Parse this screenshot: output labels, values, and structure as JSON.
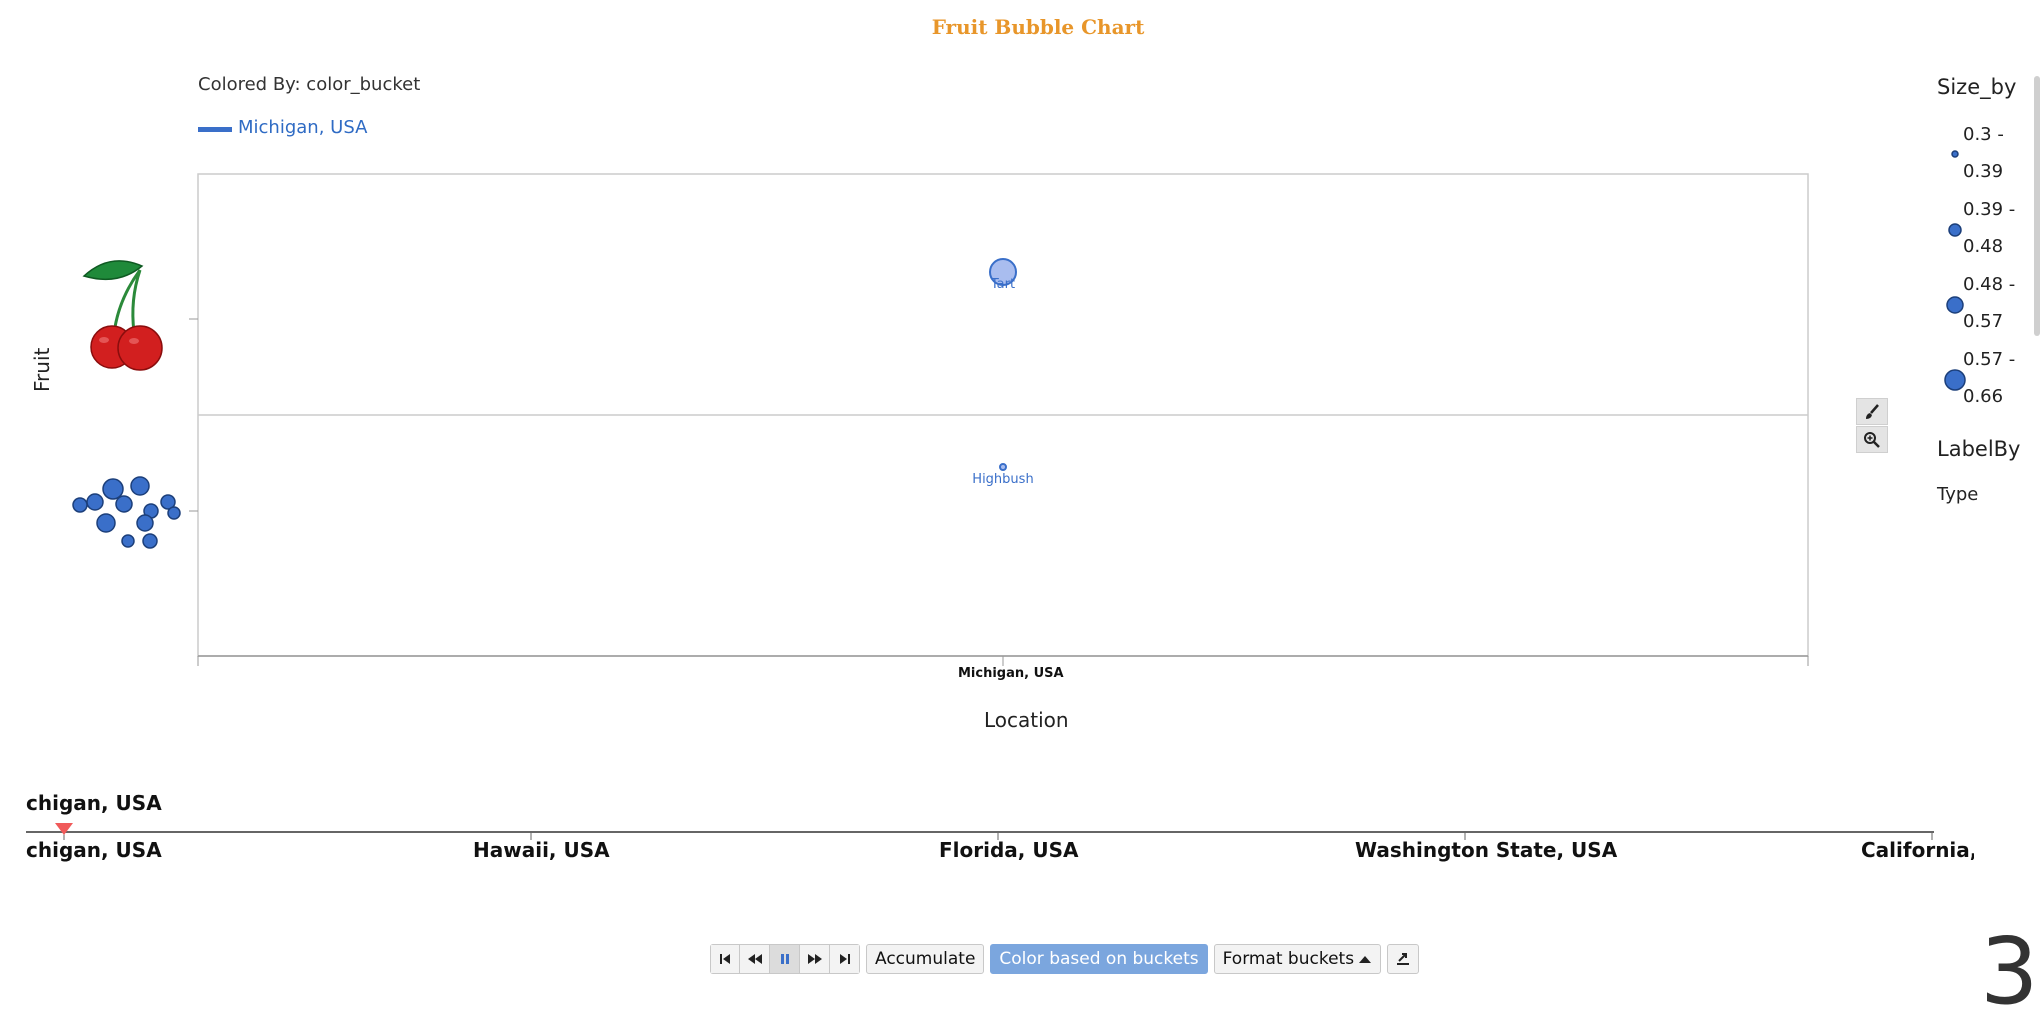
{
  "title": "Fruit Bubble Chart",
  "colored_by": "Colored By: color_bucket",
  "legend": {
    "series_label": "Michigan, USA",
    "series_color": "#3a6fc9"
  },
  "size_legend": {
    "title": "Size_by",
    "ranges": [
      {
        "line1": "0.3 -",
        "line2": "0.39"
      },
      {
        "line1": "0.39 -",
        "line2": "0.48"
      },
      {
        "line1": "0.48 -",
        "line2": "0.57"
      },
      {
        "line1": "0.57 -",
        "line2": "0.66"
      }
    ]
  },
  "label_legend": {
    "title": "LabelBy",
    "value": "Type"
  },
  "chart_data": {
    "type": "scatter",
    "title": "Fruit Bubble Chart",
    "xlabel": "Location",
    "ylabel": "Fruit",
    "x_categories": [
      "Michigan, USA"
    ],
    "y_categories": [
      "Cherry",
      "Blueberry"
    ],
    "y_category_icons": [
      "cherry-icon",
      "blueberry-icon"
    ],
    "points": [
      {
        "x": "Michigan, USA",
        "y": "Cherry",
        "label": "Tart",
        "size_bucket": "0.57 - 0.66"
      },
      {
        "x": "Michigan, USA",
        "y": "Blueberry",
        "label": "Highbush",
        "size_bucket": "0.3 - 0.39"
      }
    ],
    "bubble_color": "#a9bdef",
    "grid": true
  },
  "timeline": {
    "current": "chigan, USA",
    "labels": [
      "chigan, USA",
      "Hawaii, USA",
      "Florida, USA",
      "Washington State, USA",
      "California, U"
    ],
    "marker_color": "#f05a5a"
  },
  "controls": {
    "accumulate": "Accumulate",
    "color_buckets": "Color based on buckets",
    "format_buckets": "Format buckets"
  },
  "frame_number": "3"
}
